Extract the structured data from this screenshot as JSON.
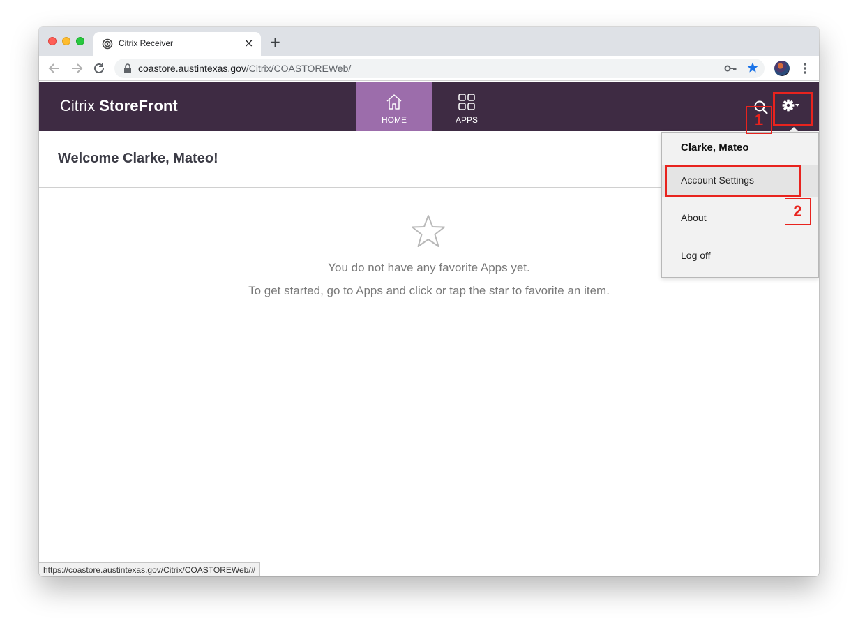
{
  "browser": {
    "tab_title": "Citrix Receiver",
    "tab_close": "×",
    "new_tab": "+",
    "url_host": "coastore.austintexas.gov",
    "url_path": "/Citrix/COASTOREWeb/",
    "status_url": "https://coastore.austintexas.gov/Citrix/COASTOREWeb/#",
    "bookmark_color": "#1a73e8"
  },
  "storefront": {
    "logo_light": "Citrix ",
    "logo_bold": "StoreFront",
    "header_color": "#3e2b43",
    "active_tab_color": "#9c6dab",
    "nav": {
      "home": "HOME",
      "apps": "APPS"
    },
    "welcome": "Welcome Clarke, Mateo!",
    "empty_line1": "You do not have any favorite Apps yet.",
    "empty_line2": "To get started, go to Apps and click or tap the star to favorite an item."
  },
  "menu": {
    "user_name": "Clarke, Mateo",
    "items": [
      {
        "label": "Account Settings"
      },
      {
        "label": "About"
      },
      {
        "label": "Log off"
      }
    ]
  },
  "annotations": {
    "step1": "1",
    "step2": "2",
    "color": "#e8231e"
  }
}
